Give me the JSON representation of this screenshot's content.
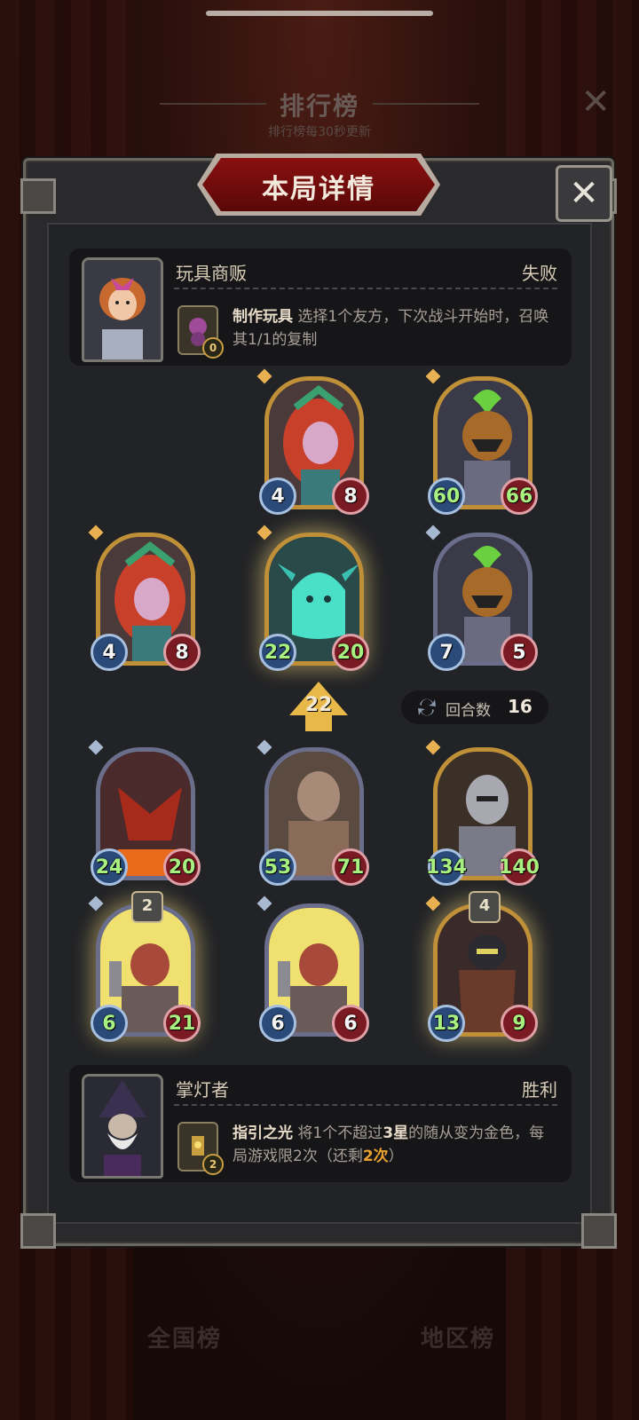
{
  "background": {
    "ranking_title": "排行榜",
    "ranking_subtitle": "排行榜每30秒更新",
    "tab_national": "全国榜",
    "tab_region": "地区榜"
  },
  "dialog": {
    "title": "本局详情",
    "close_icon": "close-icon"
  },
  "top_hero": {
    "name": "玩具商贩",
    "result": "失败",
    "ability_name": "制作玩具",
    "ability_text": "选择1个友方，下次战斗开始时，召唤其1/1的复制",
    "ability_count": "0"
  },
  "bottom_hero": {
    "name": "掌灯者",
    "result": "胜利",
    "ability_name": "指引之光",
    "ability_text_1": "将1个不超过",
    "ability_text_2": "3星",
    "ability_text_3": "的随从变为金色，每局游戏限2次（还剩",
    "ability_remaining": "2次",
    "ability_text_4": "）",
    "ability_count": "2"
  },
  "opponent_board": [
    {
      "attack": "4",
      "health": "8",
      "frame": "gold"
    },
    {
      "attack": "60",
      "health": "66",
      "frame": "gold"
    },
    {
      "attack": "4",
      "health": "8",
      "frame": "gold"
    },
    {
      "attack": "22",
      "health": "20",
      "frame": "gold"
    },
    {
      "attack": "7",
      "health": "5",
      "frame": "silver"
    }
  ],
  "damage": "22",
  "turn": {
    "label": "回合数",
    "value": "16"
  },
  "player_board": [
    {
      "attack": "24",
      "health": "20",
      "frame": "silver"
    },
    {
      "attack": "53",
      "health": "71",
      "frame": "silver"
    },
    {
      "attack": "134",
      "health": "140",
      "frame": "gold"
    },
    {
      "attack": "6",
      "health": "21",
      "frame": "silver",
      "stars": "2"
    },
    {
      "attack": "6",
      "health": "6",
      "frame": "silver"
    },
    {
      "attack": "13",
      "health": "9",
      "frame": "gold",
      "stars": "4"
    }
  ],
  "colors": {
    "accent_red": "#8a1010",
    "gold": "#c09038",
    "buff_green": "#a8f080"
  }
}
